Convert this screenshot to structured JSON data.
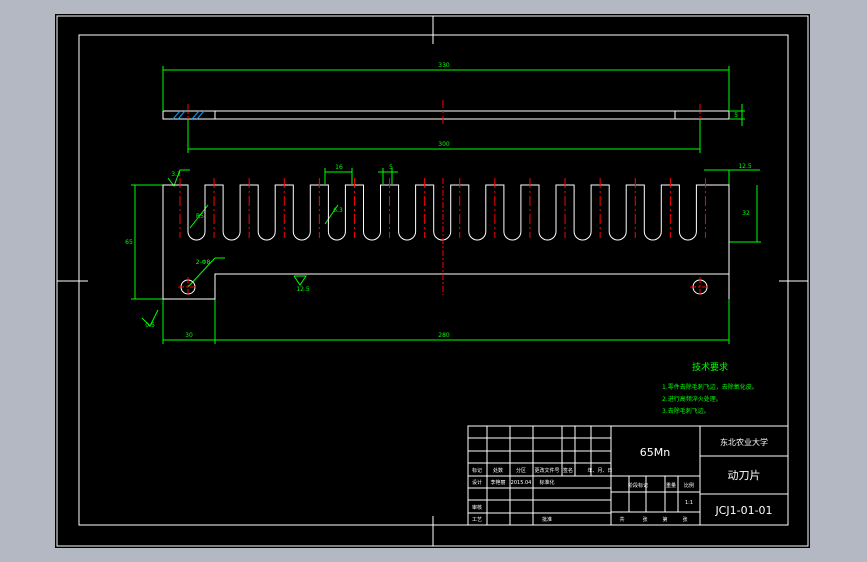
{
  "drawing": {
    "background_color": "#000000",
    "frame_color": "#ffffff",
    "part_color": "#ffffff",
    "dimension_color": "#00ff00",
    "centerline_color": "#ff0000",
    "dimensions": {
      "top_overall": "330",
      "top_inner": "300",
      "thickness_right": "5",
      "tooth_pitch": "16",
      "tooth_gap": "5",
      "roughness_top_left": "3.2",
      "right_offset": "12.5",
      "right_height": "32",
      "left_height": "65",
      "tooth_fillet": "R5",
      "hole_diameter": "2-Φ8",
      "roughness_middle": "12.5",
      "roughness_small": "0.5",
      "bottom_left": "30",
      "bottom_width": "280",
      "chamfer": "6.3"
    },
    "tech_requirements": {
      "title": "技术要求",
      "items": [
        "1.零件去除毛刺飞边，去除氧化皮。",
        "2.进行高频淬火处理。",
        "3.去除毛刺飞边。"
      ]
    },
    "title_block": {
      "material": "65Mn",
      "school": "东北农业大学",
      "part_name": "动刀片",
      "drawing_no": "JCJ1-01-01",
      "header_row": [
        "标记",
        "处数",
        "分区",
        "更改文件号",
        "签名",
        "年、月、日"
      ],
      "design_row": [
        "设计",
        "李艳丽",
        "2015.04",
        "标准化"
      ],
      "stage_labels": [
        "阶段标记",
        "重量",
        "比例"
      ],
      "scale": "1:1",
      "review_label": "审核",
      "process_label": "工艺",
      "approve_label": "批准",
      "sheet_labels": [
        "共",
        "张",
        "第",
        "张"
      ]
    }
  }
}
